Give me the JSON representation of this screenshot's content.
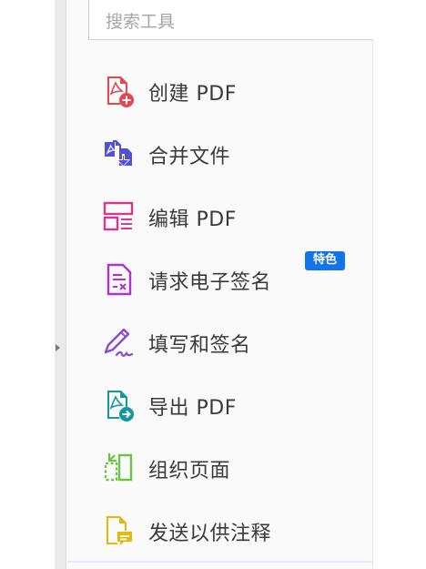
{
  "search": {
    "placeholder": "搜索工具",
    "value": ""
  },
  "tools": [
    {
      "label": "创建 PDF",
      "icon": "create-pdf-icon",
      "color": "#e34850"
    },
    {
      "label": "合并文件",
      "icon": "combine-files-icon",
      "color": "#5151d3"
    },
    {
      "label": "编辑 PDF",
      "icon": "edit-pdf-icon",
      "color": "#d83790"
    },
    {
      "label": "请求电子签名",
      "icon": "request-esign-icon",
      "color": "#b430ce",
      "badge": "特色"
    },
    {
      "label": "填写和签名",
      "icon": "fill-sign-icon",
      "color": "#8b48d6"
    },
    {
      "label": "导出 PDF",
      "icon": "export-pdf-icon",
      "color": "#12999f"
    },
    {
      "label": "组织页面",
      "icon": "organize-pages-icon",
      "color": "#6ac342"
    },
    {
      "label": "发送以供注释",
      "icon": "send-comment-icon",
      "color": "#e5b80b"
    }
  ],
  "colors": {
    "badge_bg": "#1473e6",
    "panel_bg": "#fafafa"
  }
}
